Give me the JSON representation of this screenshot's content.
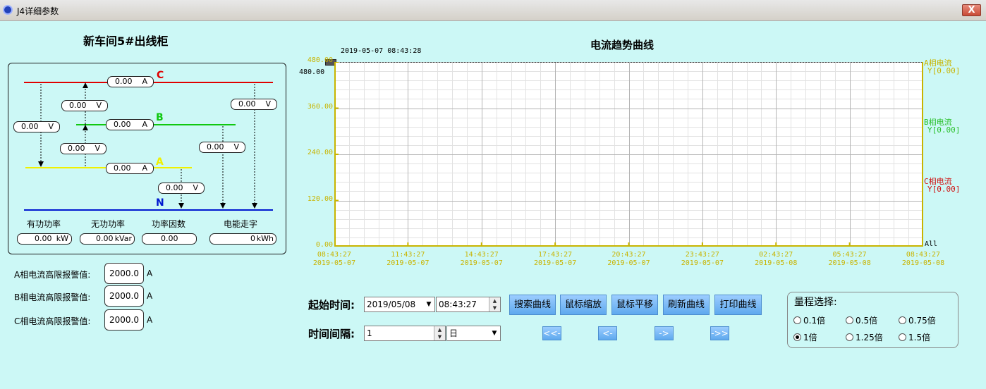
{
  "window": {
    "title": "J4详细参数",
    "close_label": "X"
  },
  "left": {
    "title": "新车间5#出线柜",
    "phase_labels": {
      "c": "C",
      "b": "B",
      "a": "A",
      "n": "N"
    },
    "current_pills": {
      "c": {
        "value": "0.00",
        "unit": "A"
      },
      "b": {
        "value": "0.00",
        "unit": "A"
      },
      "a": {
        "value": "0.00",
        "unit": "A"
      }
    },
    "voltage_pills": {
      "ca": {
        "value": "0.00",
        "unit": "V"
      },
      "cb": {
        "value": "0.00",
        "unit": "V"
      },
      "ba": {
        "value": "0.00",
        "unit": "V"
      },
      "cn": {
        "value": "0.00",
        "unit": "V"
      },
      "bn": {
        "value": "0.00",
        "unit": "V"
      },
      "an": {
        "value": "0.00",
        "unit": "V"
      }
    },
    "metrics": [
      {
        "label": "有功功率",
        "value": "0.00",
        "unit": "kW"
      },
      {
        "label": "无功功率",
        "value": "0.00",
        "unit": "kVar"
      },
      {
        "label": "功率因数",
        "value": "0.00",
        "unit": ""
      },
      {
        "label": "电能走字",
        "value": "0",
        "unit": "kWh"
      }
    ],
    "alarms": [
      {
        "label": "A相电流高限报警值:",
        "value": "2000.0",
        "unit": "A"
      },
      {
        "label": "B相电流高限报警值:",
        "value": "2000.0",
        "unit": "A"
      },
      {
        "label": "C相电流高限报警值:",
        "value": "2000.0",
        "unit": "A"
      }
    ]
  },
  "chart_data": {
    "type": "line",
    "title": "电流趋势曲线",
    "cursor_time": "2019-05-07 08:43:28",
    "cursor_value": "480.00",
    "ylim": [
      0,
      480
    ],
    "y_ticks": [
      "480.00",
      "360.00",
      "240.00",
      "120.00",
      "0.00"
    ],
    "x_ticks": [
      {
        "time": "08:43:27",
        "date": "2019-05-07"
      },
      {
        "time": "11:43:27",
        "date": "2019-05-07"
      },
      {
        "time": "14:43:27",
        "date": "2019-05-07"
      },
      {
        "time": "17:43:27",
        "date": "2019-05-07"
      },
      {
        "time": "20:43:27",
        "date": "2019-05-07"
      },
      {
        "time": "23:43:27",
        "date": "2019-05-07"
      },
      {
        "time": "02:43:27",
        "date": "2019-05-08"
      },
      {
        "time": "05:43:27",
        "date": "2019-05-08"
      },
      {
        "time": "08:43:27",
        "date": "2019-05-08"
      }
    ],
    "series": [
      {
        "name": "A相电流",
        "readout": "Y[0.00]",
        "color": "#c8b400",
        "values": []
      },
      {
        "name": "B相电流",
        "readout": "Y[0.00]",
        "color": "#2bc02b",
        "values": []
      },
      {
        "name": "C相电流",
        "readout": "Y[0.00]",
        "color": "#d01010",
        "values": []
      }
    ],
    "all_label": "All",
    "grid": true
  },
  "controls": {
    "start_label": "起始时间:",
    "start_date": "2019/05/08",
    "start_time": "08:43:27",
    "interval_label": "时间间隔:",
    "interval_value": "1",
    "interval_unit": "日",
    "buttons": [
      "搜索曲线",
      "鼠标缩放",
      "鼠标平移",
      "刷新曲线",
      "打印曲线"
    ],
    "nav": [
      "<<-",
      "<-",
      "->",
      "->>"
    ]
  },
  "range": {
    "title": "量程选择:",
    "options": [
      "0.1倍",
      "0.5倍",
      "0.75倍",
      "1倍",
      "1.25倍",
      "1.5倍"
    ],
    "selected": "1倍"
  },
  "colors": {
    "bg": "#ccf8f6",
    "phase_a": "#f0f000",
    "phase_b": "#10c810",
    "phase_c": "#e00000",
    "phase_n": "#0018d0",
    "axis": "#c8b400"
  }
}
